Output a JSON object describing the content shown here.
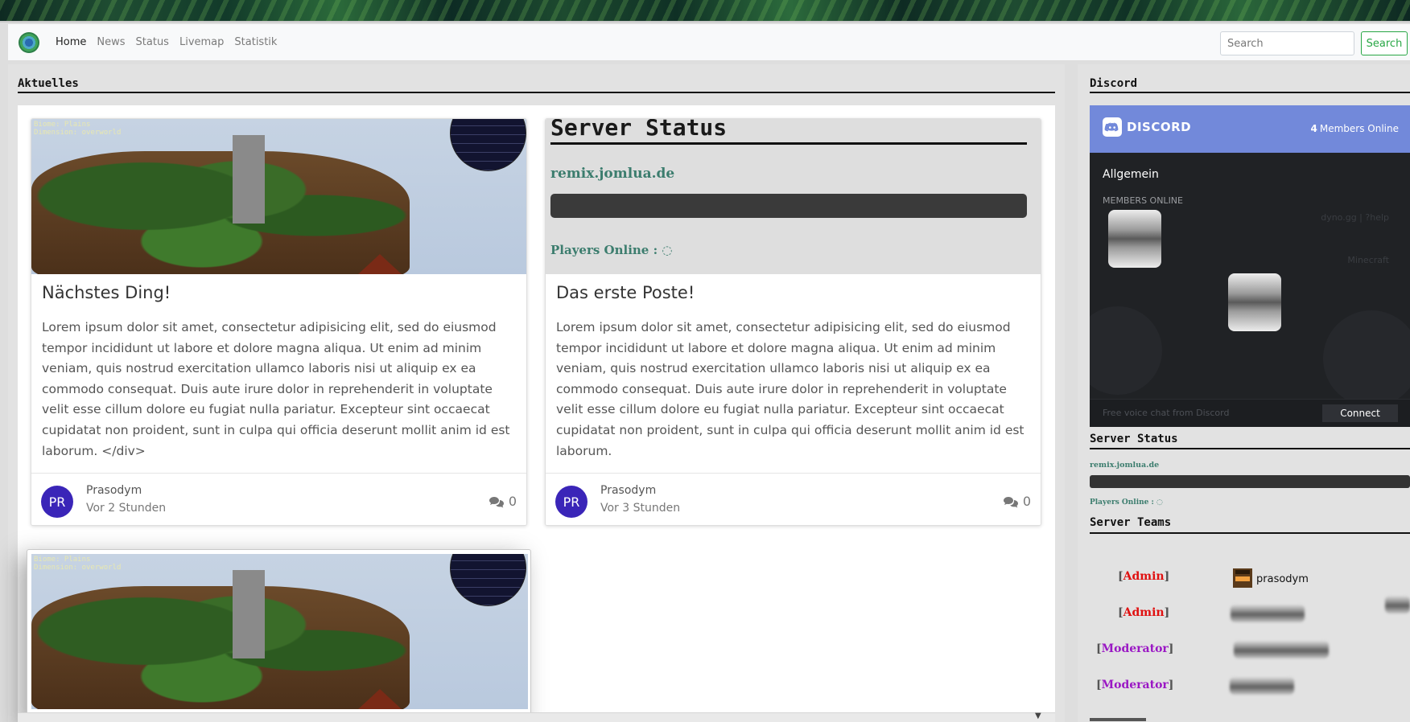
{
  "nav": {
    "items": [
      "Home",
      "News",
      "Status",
      "Livemap",
      "Statistik"
    ],
    "search_placeholder": "Search",
    "search_label": "Search"
  },
  "main": {
    "title": "Aktuelles",
    "cards": [
      {
        "title": "Nächstes Ding!",
        "text": "Lorem ipsum dolor sit amet, consectetur adipisicing elit, sed do eiusmod tempor incididunt ut labore et dolore magna aliqua. Ut enim ad minim veniam, quis nostrud exercitation ullamco laboris nisi ut aliquip ex ea commodo consequat. Duis aute irure dolor in reprehenderit in voluptate velit esse cillum dolore eu fugiat nulla pariatur. Excepteur sint occaecat cupidatat non proident, sunt in culpa qui officia deserunt mollit anim id est laborum. </div>",
        "avatar_initials": "PR",
        "author": "Prasodym",
        "time": "Vor 2 Stunden",
        "comments": "0",
        "image_overlay": [
          "Biome: Plains",
          "Dimension: overworld"
        ]
      },
      {
        "title": "Das erste Poste!",
        "text": "Lorem ipsum dolor sit amet, consectetur adipisicing elit, sed do eiusmod tempor incididunt ut labore et dolore magna aliqua. Ut enim ad minim veniam, quis nostrud exercitation ullamco laboris nisi ut aliquip ex ea commodo consequat. Duis aute irure dolor in reprehenderit in voluptate velit esse cillum dolore eu fugiat nulla pariatur. Excepteur sint occaecat cupidatat non proident, sunt in culpa qui officia deserunt mollit anim id est laborum.",
        "avatar_initials": "PR",
        "author": "Prasodym",
        "time": "Vor 3 Stunden",
        "comments": "0",
        "status_image": {
          "title": "Server Status",
          "host": "remix.jomlua.de",
          "players_label": "Players Online :"
        }
      },
      {
        "image_overlay": [
          "Biome: Plains",
          "Dimension: overworld"
        ]
      }
    ]
  },
  "sidebar": {
    "discord_title": "Discord",
    "discord": {
      "logo_text": "DISCORD",
      "members_count": "4",
      "members_label": "Members Online",
      "channel": "Allgemein",
      "members_header": "MEMBERS ONLINE",
      "bot_text": "dyno.gg | ?help",
      "game_text": "Minecraft",
      "footer_text": "Free voice chat from Discord",
      "connect_label": "Connect"
    },
    "server_status": {
      "title": "Server Status",
      "host": "remix.jomlua.de",
      "players_label": "Players Online :"
    },
    "teams": {
      "title": "Server Teams",
      "ranks": [
        {
          "name": "Admin",
          "player": "prasodym"
        },
        {
          "name": "Admin",
          "player": ""
        },
        {
          "name": "Moderator",
          "player": ""
        },
        {
          "name": "Moderator",
          "player": ""
        }
      ]
    }
  },
  "colors": {
    "accent": "#28a745",
    "discord": "#7289da",
    "admin": "#e01010",
    "moderator": "#9a17c4",
    "avatar": "#3a25b8"
  }
}
